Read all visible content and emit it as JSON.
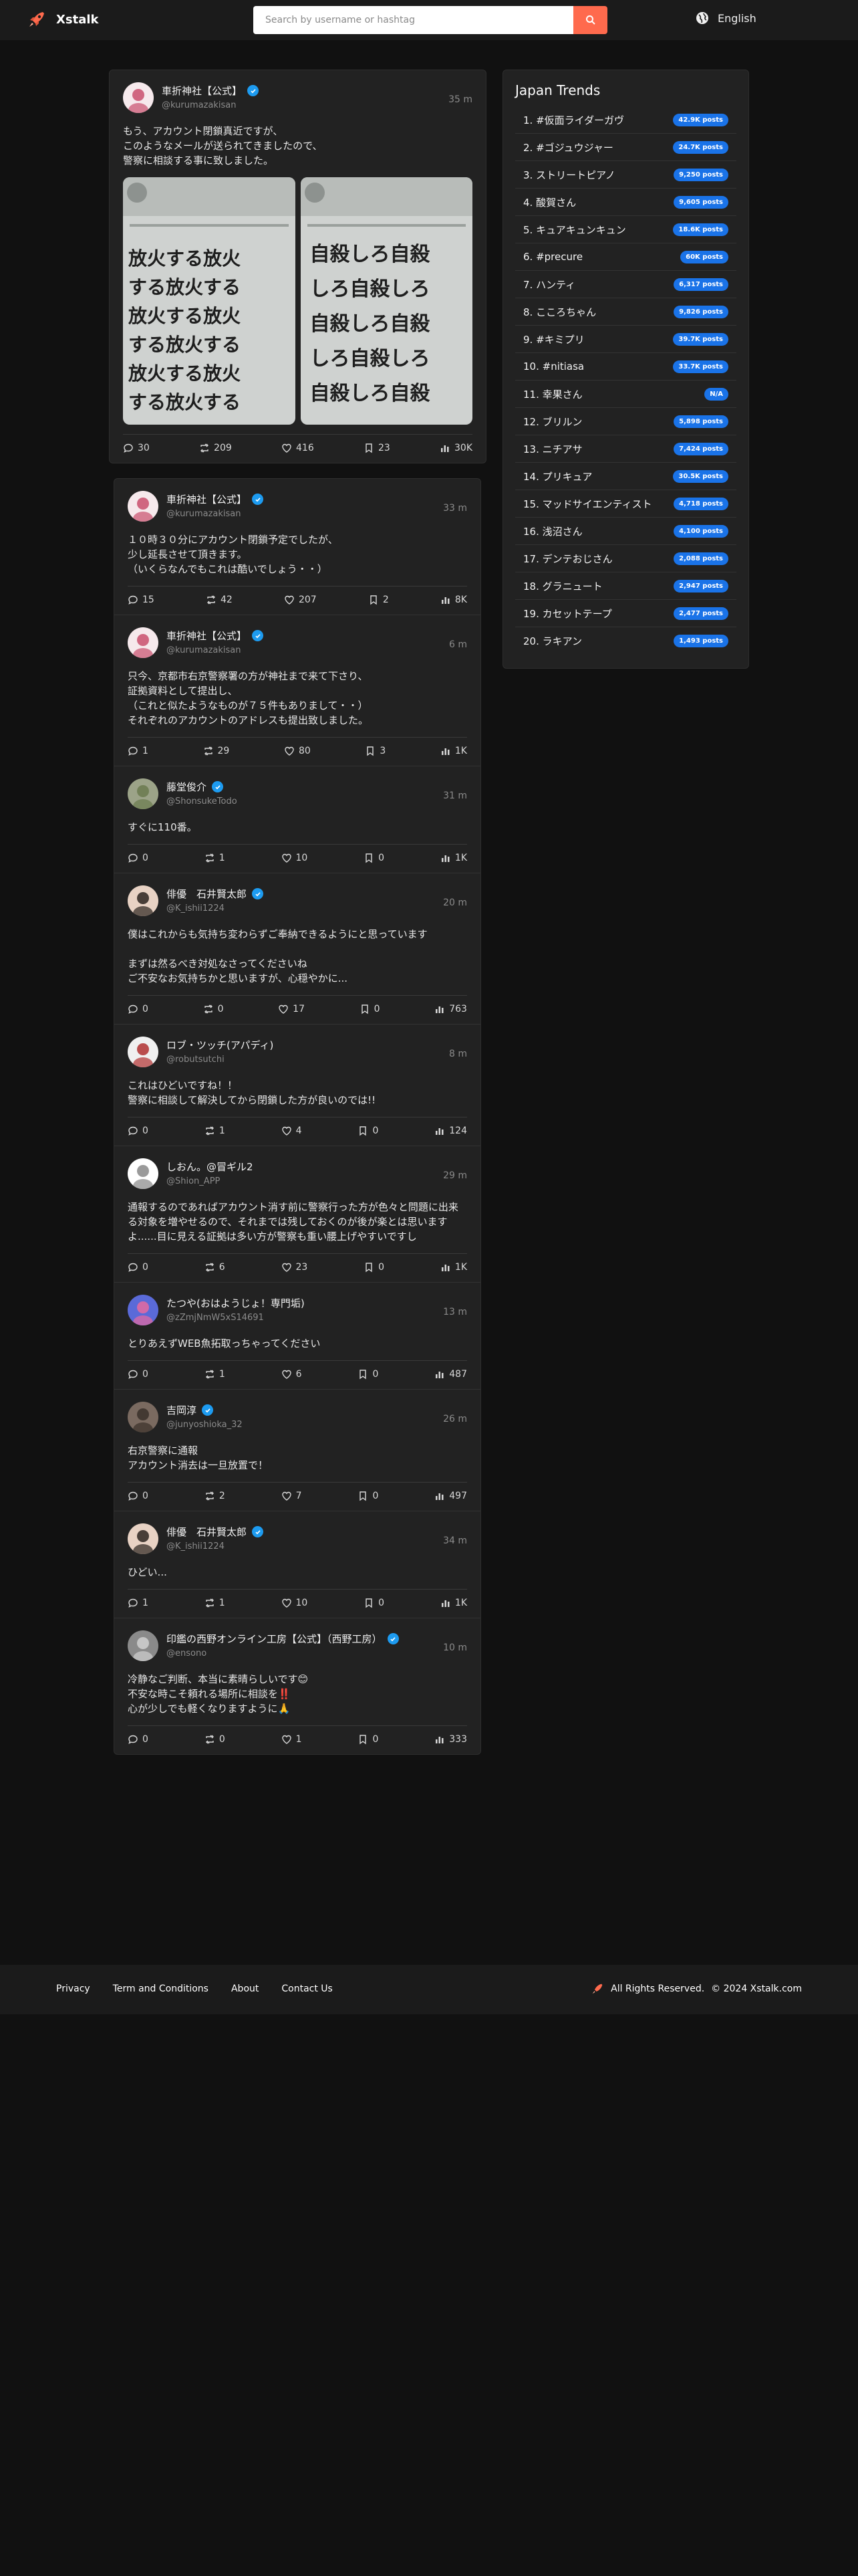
{
  "header": {
    "brand": "Xstalk",
    "search_placeholder": "Search by username or hashtag",
    "language": "English"
  },
  "posts": [
    {
      "display_name": "車折神社【公式】",
      "handle": "@kurumazakisan",
      "verified": true,
      "time": "35 m",
      "text": "もう、アカウント閉鎖真近ですが、\nこのようなメールが送られてきましたので、\n警察に相談する事に致しました。",
      "images": [
        {
          "lines": [
            "放火する放火",
            "する放火する",
            "放火する放火",
            "する放火する",
            "放火する放火",
            "する放火する"
          ]
        },
        {
          "lines": [
            "自殺しろ自殺",
            "しろ自殺しろ",
            "自殺しろ自殺",
            "しろ自殺しろ",
            "自殺しろ自殺"
          ]
        }
      ],
      "stats": {
        "replies": "30",
        "retweets": "209",
        "likes": "416",
        "bookmarks": "23",
        "views": "30K"
      }
    },
    {
      "display_name": "車折神社【公式】",
      "handle": "@kurumazakisan",
      "verified": true,
      "time": "33 m",
      "text": "１０時３０分にアカウント閉鎖予定でしたが、\n少し延長させて頂きます。\n（いくらなんでもこれは酷いでしょう・・）",
      "stats": {
        "replies": "15",
        "retweets": "42",
        "likes": "207",
        "bookmarks": "2",
        "views": "8K"
      }
    },
    {
      "display_name": "車折神社【公式】",
      "handle": "@kurumazakisan",
      "verified": true,
      "time": "6 m",
      "text": "只今、京都市右京警察署の方が神社まで来て下さり、\n証拠資料として提出し、\n（これと似たようなものが７５件もありまして・・）\nそれぞれのアカウントのアドレスも提出致しました。",
      "stats": {
        "replies": "1",
        "retweets": "29",
        "likes": "80",
        "bookmarks": "3",
        "views": "1K"
      }
    },
    {
      "display_name": "藤堂俊介",
      "handle": "@ShonsukeTodo",
      "verified": true,
      "time": "31 m",
      "text": "すぐに110番。",
      "stats": {
        "replies": "0",
        "retweets": "1",
        "likes": "10",
        "bookmarks": "0",
        "views": "1K"
      }
    },
    {
      "display_name": "俳優　石井賢太郎",
      "handle": "@K_ishii1224",
      "verified": true,
      "time": "20 m",
      "text": "僕はこれからも気持ち変わらずご奉納できるようにと思っています\n\nまずは然るべき対処なさってくださいね\nご不安なお気持ちかと思いますが、心穏やかに...",
      "stats": {
        "replies": "0",
        "retweets": "0",
        "likes": "17",
        "bookmarks": "0",
        "views": "763"
      }
    },
    {
      "display_name": "ロブ・ツッチ(アパディ)",
      "handle": "@robutsutchi",
      "verified": false,
      "time": "8 m",
      "text": "これはひどいですね！！\n警察に相談して解決してから閉鎖した方が良いのでは!!",
      "stats": {
        "replies": "0",
        "retweets": "1",
        "likes": "4",
        "bookmarks": "0",
        "views": "124"
      }
    },
    {
      "display_name": "しおん。@冒ギル2",
      "handle": "@Shion_APP",
      "verified": false,
      "time": "29 m",
      "text": "通報するのであればアカウント消す前に警察行った方が色々と問題に出来る対象を増やせるので、それまでは残しておくのが後が楽とは思いますよ......目に見える証拠は多い方が警察も重い腰上げやすいですし",
      "stats": {
        "replies": "0",
        "retweets": "6",
        "likes": "23",
        "bookmarks": "0",
        "views": "1K"
      }
    },
    {
      "display_name": "たつや(おはようじょ！専門垢)",
      "handle": "@zZmjNmW5xS14691",
      "verified": false,
      "time": "13 m",
      "text": "とりあえずWEB魚拓取っちゃってください",
      "stats": {
        "replies": "0",
        "retweets": "1",
        "likes": "6",
        "bookmarks": "0",
        "views": "487"
      }
    },
    {
      "display_name": "吉岡淳",
      "handle": "@junyoshioka_32",
      "verified": true,
      "time": "26 m",
      "text": "右京警察に通報\nアカウント消去は一旦放置で！",
      "stats": {
        "replies": "0",
        "retweets": "2",
        "likes": "7",
        "bookmarks": "0",
        "views": "497"
      }
    },
    {
      "display_name": "俳優　石井賢太郎",
      "handle": "@K_ishii1224",
      "verified": true,
      "time": "34 m",
      "text": "ひどい...",
      "stats": {
        "replies": "1",
        "retweets": "1",
        "likes": "10",
        "bookmarks": "0",
        "views": "1K"
      }
    },
    {
      "display_name": "印鑑の西野オンライン工房【公式】（西野工房）",
      "handle": "@ensono",
      "verified": true,
      "time": "10 m",
      "text": "冷静なご判断、本当に素晴らしいです😊\n不安な時こそ頼れる場所に相談を‼️\n心が少しでも軽くなりますように🙏",
      "stats": {
        "replies": "0",
        "retweets": "0",
        "likes": "1",
        "bookmarks": "0",
        "views": "333"
      }
    }
  ],
  "trends": {
    "title": "Japan Trends",
    "items": [
      {
        "label": "1. #仮面ライダーガヴ",
        "posts": "42.9K posts"
      },
      {
        "label": "2. #ゴジュウジャー",
        "posts": "24.7K posts"
      },
      {
        "label": "3. ストリートピアノ",
        "posts": "9,250 posts"
      },
      {
        "label": "4. 酸賀さん",
        "posts": "9,605 posts"
      },
      {
        "label": "5. キュアキュンキュン",
        "posts": "18.6K posts"
      },
      {
        "label": "6. #precure",
        "posts": "60K posts"
      },
      {
        "label": "7. ハンティ",
        "posts": "6,317 posts"
      },
      {
        "label": "8. こころちゃん",
        "posts": "9,826 posts"
      },
      {
        "label": "9. #キミプリ",
        "posts": "39.7K posts"
      },
      {
        "label": "10. #nitiasa",
        "posts": "33.7K posts"
      },
      {
        "label": "11. 幸果さん",
        "posts": "N/A"
      },
      {
        "label": "12. ブリルン",
        "posts": "5,898 posts"
      },
      {
        "label": "13. ニチアサ",
        "posts": "7,424 posts"
      },
      {
        "label": "14. プリキュア",
        "posts": "30.5K posts"
      },
      {
        "label": "15. マッドサイエンティスト",
        "posts": "4,718 posts"
      },
      {
        "label": "16. 浅沼さん",
        "posts": "4,100 posts"
      },
      {
        "label": "17. デンテおじさん",
        "posts": "2,088 posts"
      },
      {
        "label": "18. グラニュート",
        "posts": "2,947 posts"
      },
      {
        "label": "19. カセットテープ",
        "posts": "2,477 posts"
      },
      {
        "label": "20. ラキアン",
        "posts": "1,493 posts"
      }
    ]
  },
  "footer": {
    "links": [
      "Privacy",
      "Term and Conditions",
      "About",
      "Contact Us"
    ],
    "rights": "All Rights Reserved.",
    "copyright": "© 2024 Xstalk.com"
  },
  "colors": {
    "accent": "#ff6a4d",
    "badge": "#1a73e8",
    "verified": "#1d9bf0",
    "card": "#222222",
    "background": "#111111"
  }
}
